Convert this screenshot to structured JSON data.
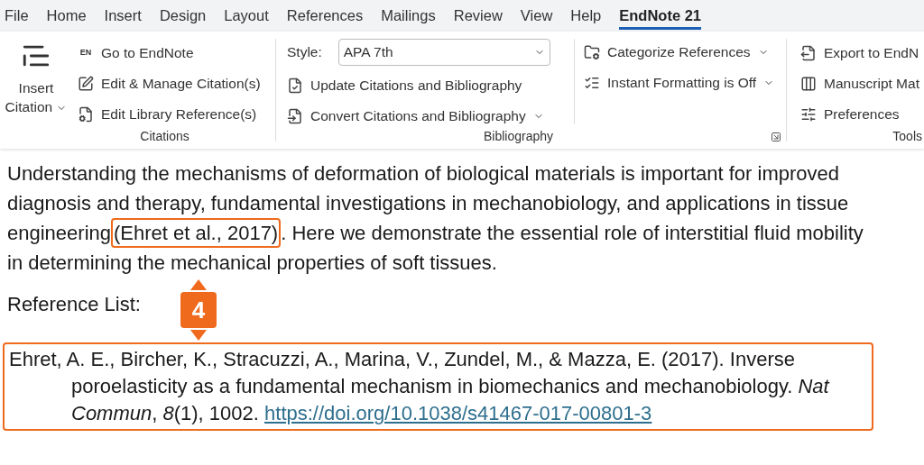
{
  "tabs": [
    {
      "label": "File",
      "selected": false
    },
    {
      "label": "Home",
      "selected": false
    },
    {
      "label": "Insert",
      "selected": false
    },
    {
      "label": "Design",
      "selected": false
    },
    {
      "label": "Layout",
      "selected": false
    },
    {
      "label": "References",
      "selected": false
    },
    {
      "label": "Mailings",
      "selected": false
    },
    {
      "label": "Review",
      "selected": false
    },
    {
      "label": "View",
      "selected": false
    },
    {
      "label": "Help",
      "selected": false
    },
    {
      "label": "EndNote 21",
      "selected": true
    }
  ],
  "ribbon": {
    "citations": {
      "insert_button": "Insert Citation",
      "items": [
        {
          "kind": "en",
          "badge": "EN",
          "label": "Go to EndNote"
        },
        {
          "kind": "edit",
          "label": "Edit & Manage Citation(s)"
        },
        {
          "kind": "library",
          "label": "Edit Library Reference(s)"
        }
      ],
      "label": "Citations"
    },
    "bibliography": {
      "style_label": "Style:",
      "style_value": "APA 7th",
      "items": [
        {
          "kind": "update",
          "label": "Update Citations and Bibliography",
          "has_menu": false
        },
        {
          "kind": "convert",
          "label": "Convert Citations and Bibliography",
          "has_menu": true
        }
      ],
      "right_items": [
        {
          "kind": "categorize",
          "label": "Categorize References",
          "has_menu": true
        },
        {
          "kind": "instant",
          "label": "Instant Formatting is Off",
          "has_menu": true
        }
      ],
      "label": "Bibliography"
    },
    "tools": {
      "items": [
        {
          "kind": "export",
          "label": "Export to EndN"
        },
        {
          "kind": "manuscript",
          "label": "Manuscript Mat"
        },
        {
          "kind": "preferences",
          "label": "Preferences"
        }
      ],
      "label": "Tools"
    }
  },
  "document": {
    "paragraph": {
      "before": "Understanding the mechanisms of deformation of biological materials is important for improved diagnosis and therapy, fundamental investigations in mechanobiology, and applications in tissue engineering",
      "citation": "(Ehret et al., 2017)",
      "citation_highlighted": true,
      "after": ". Here we demonstrate the essential role of interstitial fluid mobility in determining the mechanical properties of soft tissues."
    },
    "heading": "Reference List:",
    "references": [
      {
        "text": "Ehret, A. E., Bircher, K., Stracuzzi, A., Marina, V., Zundel, M., & Mazza, E. (2017). Inverse poroelasticity as a fundamental mechanism in biomechanics and mechanobiology. *Nat Commun*, *8*(1), 1002.",
        "link": "https://doi.org/10.1038/s41467-017-00801-3",
        "highlighted": true
      }
    ],
    "step_marker": "4"
  }
}
